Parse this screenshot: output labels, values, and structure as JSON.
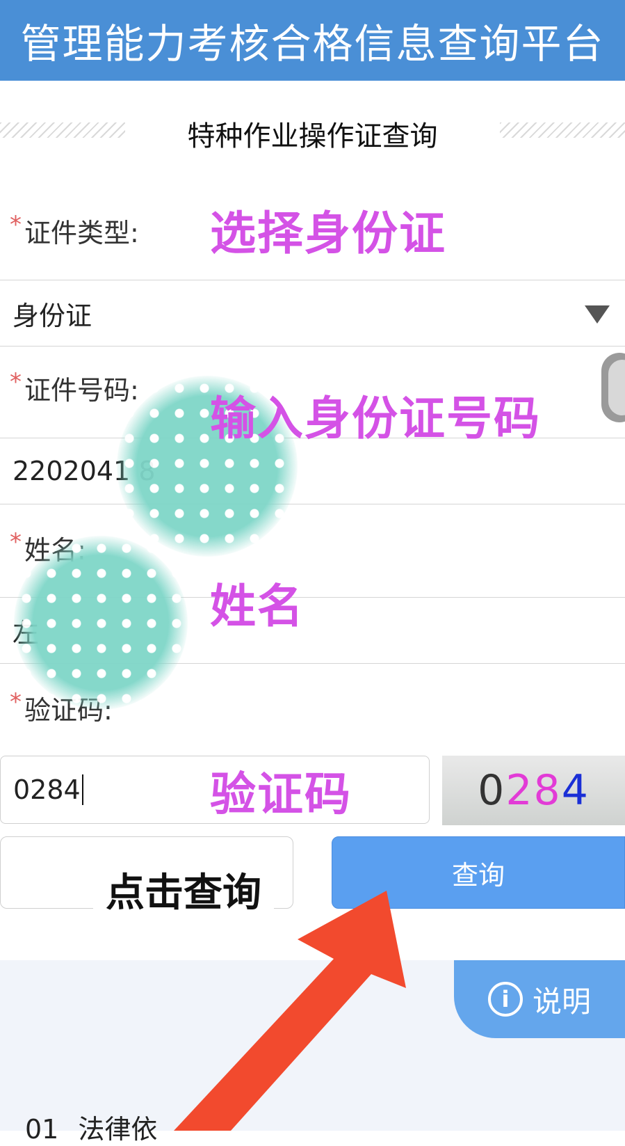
{
  "header": {
    "title": "管理能力考核合格信息查询平台"
  },
  "subtitle": "特种作业操作证查询",
  "form": {
    "required_mark": "*",
    "doc_type": {
      "label": "证件类型:",
      "value": "身份证"
    },
    "doc_number": {
      "label": "证件号码:",
      "value": "2202041 8"
    },
    "name": {
      "label": "姓名:",
      "value": "左"
    },
    "captcha": {
      "label": "验证码:",
      "value": "0284",
      "image_digits": [
        "0",
        "2",
        "8",
        "4"
      ]
    }
  },
  "buttons": {
    "query": "查询",
    "info": "说明"
  },
  "info_list": [
    {
      "number": "01",
      "text": "法律依"
    }
  ],
  "annotations": {
    "select_id": "选择身份证",
    "input_id": "输入身份证号码",
    "name": "姓名",
    "captcha": "验证码",
    "click_query": "点击查询"
  },
  "colors": {
    "header_bg": "#4a8fd6",
    "query_button": "#5a9ff0",
    "annotation": "#d452e6",
    "arrow": "#f24a2e",
    "captcha_digits": [
      "#333333",
      "#e23bd6",
      "#e23bd6",
      "#1a2fd6"
    ]
  }
}
